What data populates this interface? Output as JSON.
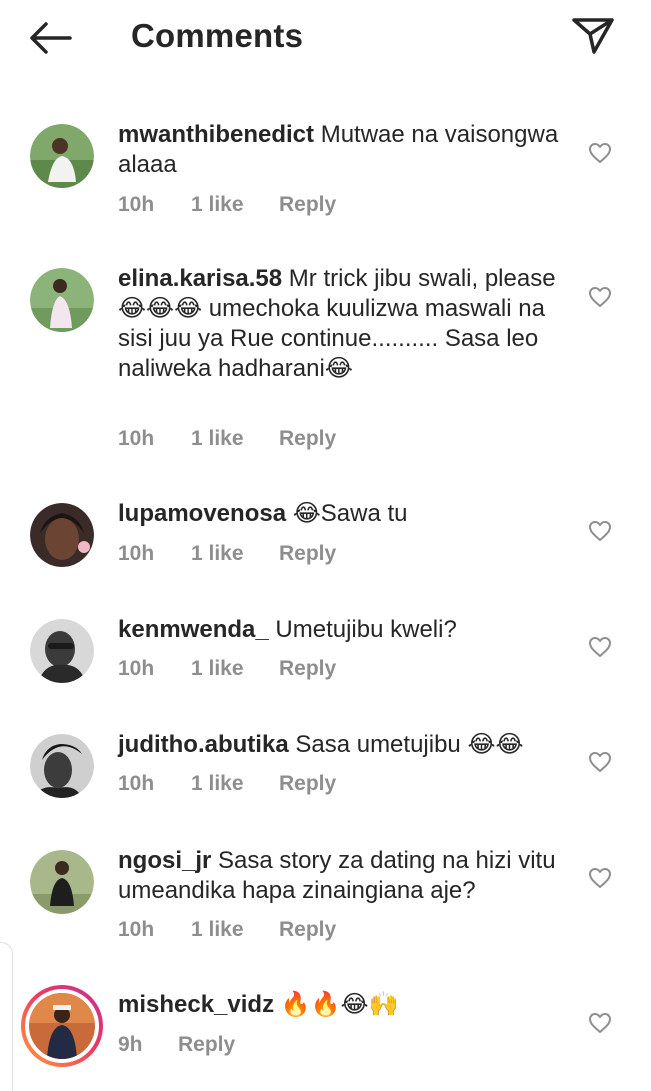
{
  "header": {
    "title": "Comments",
    "back_icon": "arrow-left-icon",
    "share_icon": "paper-plane-icon"
  },
  "comments": [
    {
      "username": "mwanthibenedict",
      "text": "Mutwae na vaisongwa alaaa",
      "time": "10h",
      "likes": "1 like",
      "reply": "Reply"
    },
    {
      "username": "elina.karisa.58",
      "text": "Mr trick jibu swali, please 😂😂😂 umechoka kuulizwa maswali na sisi juu ya Rue continue.......... Sasa leo naliweka hadharani😂",
      "time": "10h",
      "likes": "1 like",
      "reply": "Reply"
    },
    {
      "username": "lupamovenosa",
      "text": "😂Sawa tu",
      "time": "10h",
      "likes": "1 like",
      "reply": "Reply"
    },
    {
      "username": "kenmwenda_",
      "text": "Umetujibu kweli?",
      "time": "10h",
      "likes": "1 like",
      "reply": "Reply"
    },
    {
      "username": "juditho.abutika",
      "text": "Sasa umetujibu 😂😂",
      "time": "10h",
      "likes": "1 like",
      "reply": "Reply"
    },
    {
      "username": "ngosi_jr",
      "text": "Sasa story za dating na hizi vitu umeandika hapa zinaingiana aje?",
      "time": "10h",
      "likes": "1 like",
      "reply": "Reply"
    },
    {
      "username": "misheck_vidz",
      "text": "🔥🔥😂🙌",
      "time": "9h",
      "reply": "Reply"
    }
  ],
  "colors": {
    "text": "#262626",
    "meta": "#8e8e8e",
    "story_ring_start": "#f9a23a",
    "story_ring_end": "#c22f95"
  }
}
